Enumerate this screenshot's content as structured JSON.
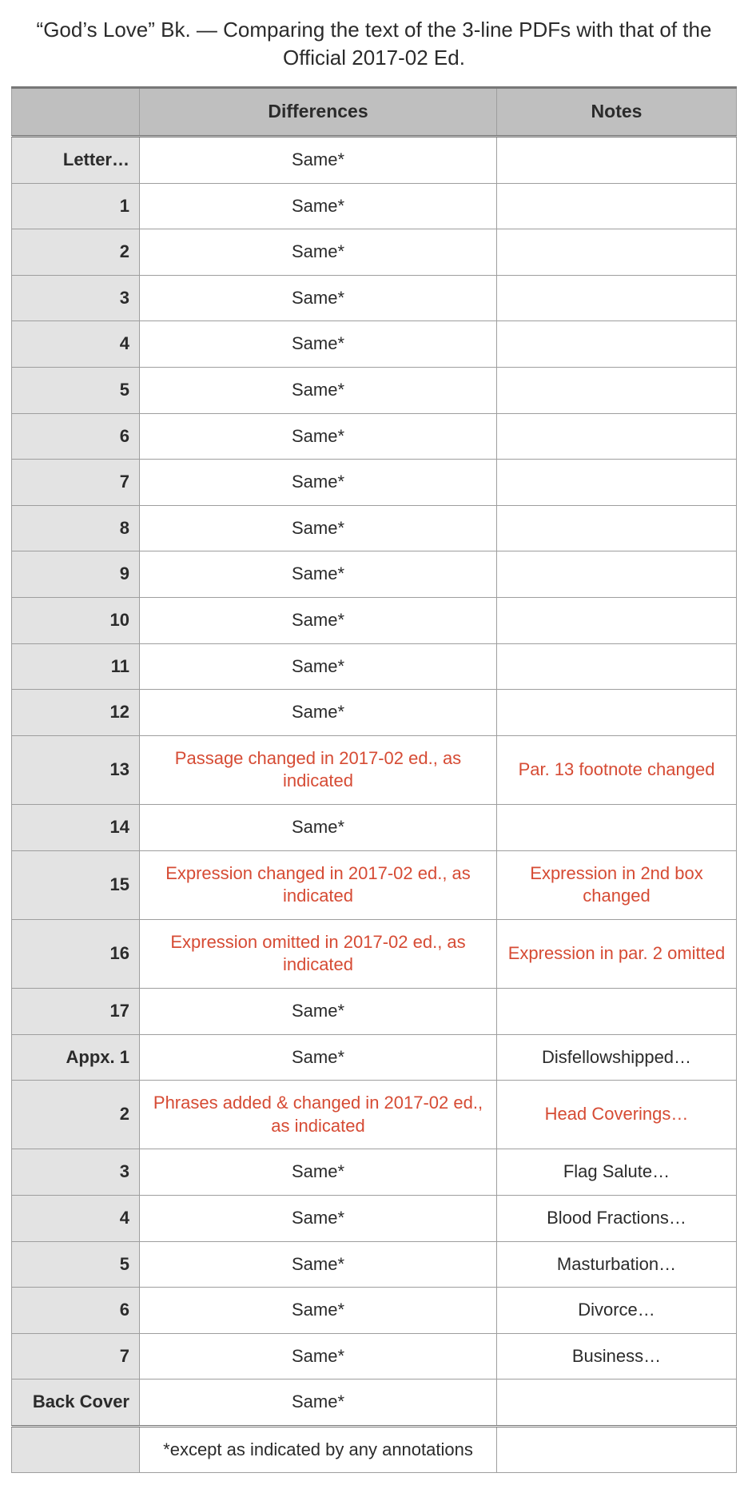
{
  "title": "“God’s Love” Bk. — Comparing the text of the 3-line PDFs with that of the Official 2017-02 Ed.",
  "headers": {
    "c1": "",
    "c2": "Differences",
    "c3": "Notes"
  },
  "rows": [
    {
      "label": "Letter…",
      "diff": "Same*",
      "notes": "",
      "changed": false
    },
    {
      "label": "1",
      "diff": "Same*",
      "notes": "",
      "changed": false
    },
    {
      "label": "2",
      "diff": "Same*",
      "notes": "",
      "changed": false
    },
    {
      "label": "3",
      "diff": "Same*",
      "notes": "",
      "changed": false
    },
    {
      "label": "4",
      "diff": "Same*",
      "notes": "",
      "changed": false
    },
    {
      "label": "5",
      "diff": "Same*",
      "notes": "",
      "changed": false
    },
    {
      "label": "6",
      "diff": "Same*",
      "notes": "",
      "changed": false
    },
    {
      "label": "7",
      "diff": "Same*",
      "notes": "",
      "changed": false
    },
    {
      "label": "8",
      "diff": "Same*",
      "notes": "",
      "changed": false
    },
    {
      "label": "9",
      "diff": "Same*",
      "notes": "",
      "changed": false
    },
    {
      "label": "10",
      "diff": "Same*",
      "notes": "",
      "changed": false
    },
    {
      "label": "11",
      "diff": "Same*",
      "notes": "",
      "changed": false
    },
    {
      "label": "12",
      "diff": "Same*",
      "notes": "",
      "changed": false
    },
    {
      "label": "13",
      "diff": "Passage changed in 2017-02 ed., as indicated",
      "notes": "Par. 13 footnote changed",
      "changed": true
    },
    {
      "label": "14",
      "diff": "Same*",
      "notes": "",
      "changed": false
    },
    {
      "label": "15",
      "diff": "Expression changed in 2017-02 ed., as indicated",
      "notes": "Expression in 2nd box changed",
      "changed": true
    },
    {
      "label": "16",
      "diff": "Expression omitted in 2017-02 ed., as indicated",
      "notes": "Expression in par. 2 omitted",
      "changed": true
    },
    {
      "label": "17",
      "diff": "Same*",
      "notes": "",
      "changed": false
    },
    {
      "label": "Appx. 1",
      "diff": "Same*",
      "notes": "Disfellowshipped…",
      "changed": false
    },
    {
      "label": "2",
      "diff": "Phrases added & changed in 2017-02 ed., as indicated",
      "notes": "Head Coverings…",
      "changed": true
    },
    {
      "label": "3",
      "diff": "Same*",
      "notes": "Flag Salute…",
      "changed": false
    },
    {
      "label": "4",
      "diff": "Same*",
      "notes": "Blood Fractions…",
      "changed": false
    },
    {
      "label": "5",
      "diff": "Same*",
      "notes": "Masturbation…",
      "changed": false
    },
    {
      "label": "6",
      "diff": "Same*",
      "notes": "Divorce…",
      "changed": false
    },
    {
      "label": "7",
      "diff": "Same*",
      "notes": "Business…",
      "changed": false
    },
    {
      "label": "Back Cover",
      "diff": "Same*",
      "notes": "",
      "changed": false
    }
  ],
  "footnote": {
    "label": "",
    "diff": "*except as indicated by any annotations",
    "notes": ""
  }
}
